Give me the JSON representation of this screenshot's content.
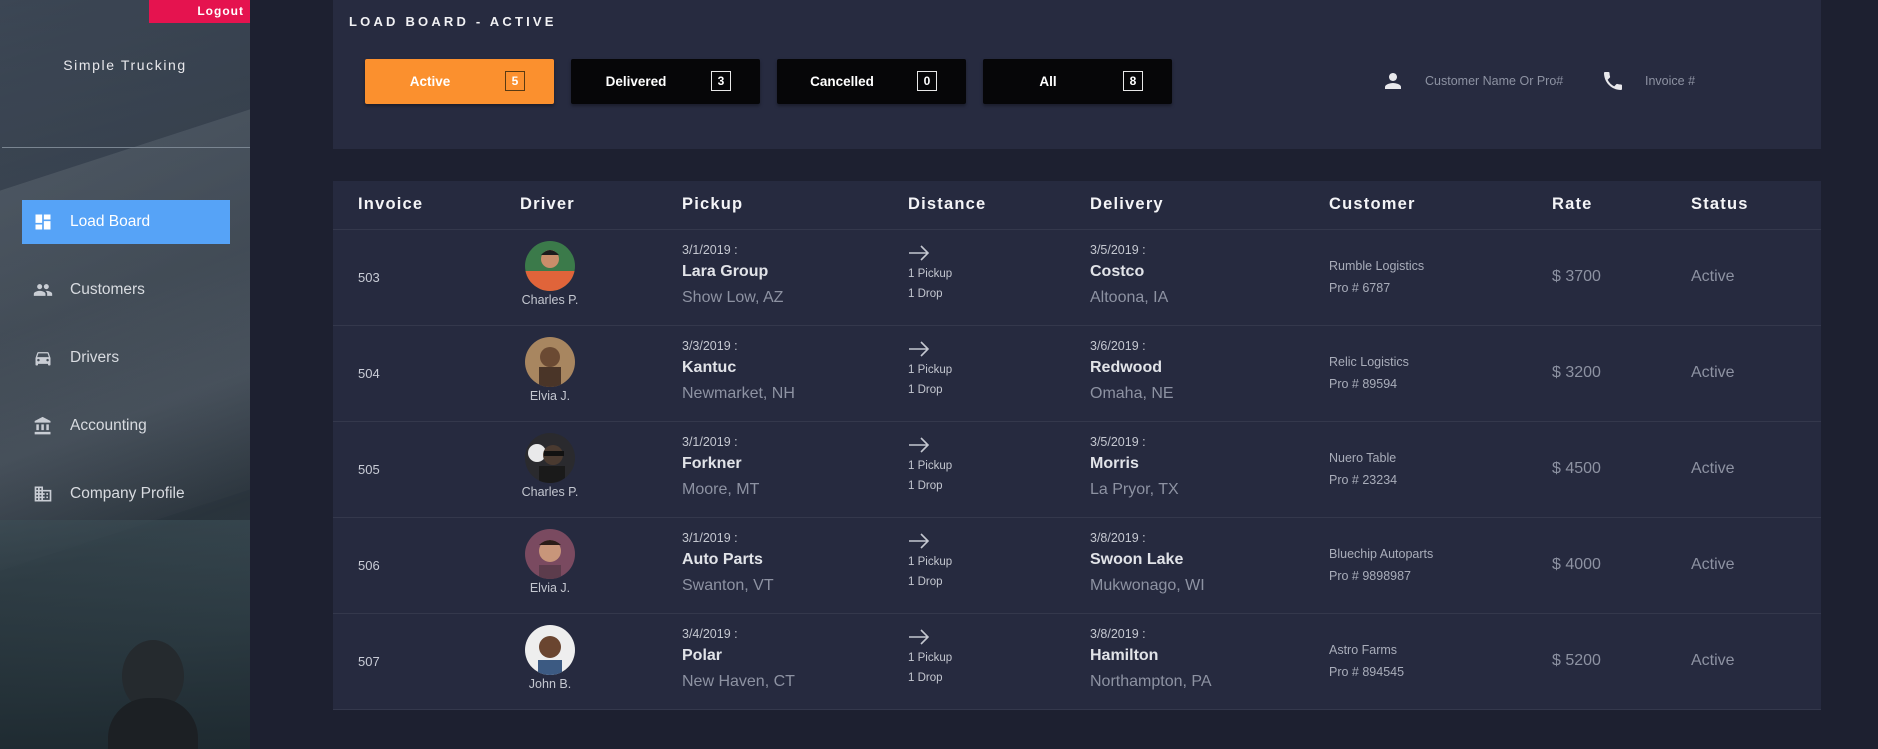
{
  "sidebar": {
    "logout": "Logout",
    "brand": "Simple Trucking",
    "nav": [
      {
        "label": "Load Board",
        "icon": "dashboard-icon",
        "active": true
      },
      {
        "label": "Customers",
        "icon": "people-icon",
        "active": false
      },
      {
        "label": "Drivers",
        "icon": "car-icon",
        "active": false
      },
      {
        "label": "Accounting",
        "icon": "bank-icon",
        "active": false
      },
      {
        "label": "Company Profile",
        "icon": "building-icon",
        "active": false
      }
    ]
  },
  "header": {
    "title": "LOAD BOARD - ACTIVE",
    "filters": [
      {
        "label": "Active",
        "count": "5",
        "active": true
      },
      {
        "label": "Delivered",
        "count": "3",
        "active": false
      },
      {
        "label": "Cancelled",
        "count": "0",
        "active": false
      },
      {
        "label": "All",
        "count": "8",
        "active": false
      }
    ],
    "search_customer": {
      "placeholder": "Customer Name Or Pro#",
      "value": "",
      "icon": "person-icon"
    },
    "search_invoice": {
      "placeholder": "Invoice #",
      "value": "",
      "icon": "phone-icon"
    }
  },
  "table": {
    "columns": [
      "Invoice",
      "Driver",
      "Pickup",
      "Distance",
      "Delivery",
      "Customer",
      "Rate",
      "Status"
    ],
    "rows": [
      {
        "invoice": "503",
        "driver": "Charles P.",
        "pickup_date": "3/1/2019 :",
        "pickup_name": "Lara Group",
        "pickup_city": "Show Low, AZ",
        "pickups": "1 Pickup",
        "drops": "1 Drop",
        "delivery_date": "3/5/2019 :",
        "delivery_name": "Costco",
        "delivery_city": "Altoona, IA",
        "customer": "Rumble Logistics",
        "pro": "Pro # 6787",
        "rate": "$ 3700",
        "status": "Active"
      },
      {
        "invoice": "504",
        "driver": "Elvia J.",
        "pickup_date": "3/3/2019 :",
        "pickup_name": "Kantuc",
        "pickup_city": "Newmarket, NH",
        "pickups": "1 Pickup",
        "drops": "1 Drop",
        "delivery_date": "3/6/2019 :",
        "delivery_name": "Redwood",
        "delivery_city": "Omaha, NE",
        "customer": "Relic Logistics",
        "pro": "Pro # 89594",
        "rate": "$ 3200",
        "status": "Active"
      },
      {
        "invoice": "505",
        "driver": "Charles P.",
        "pickup_date": "3/1/2019 :",
        "pickup_name": "Forkner",
        "pickup_city": "Moore, MT",
        "pickups": "1 Pickup",
        "drops": "1 Drop",
        "delivery_date": "3/5/2019 :",
        "delivery_name": "Morris",
        "delivery_city": "La Pryor, TX",
        "customer": "Nuero Table",
        "pro": "Pro # 23234",
        "rate": "$ 4500",
        "status": "Active"
      },
      {
        "invoice": "506",
        "driver": "Elvia J.",
        "pickup_date": "3/1/2019 :",
        "pickup_name": "Auto Parts",
        "pickup_city": "Swanton, VT",
        "pickups": "1 Pickup",
        "drops": "1 Drop",
        "delivery_date": "3/8/2019 :",
        "delivery_name": "Swoon Lake",
        "delivery_city": "Mukwonago, WI",
        "customer": "Bluechip Autoparts",
        "pro": "Pro # 9898987",
        "rate": "$ 4000",
        "status": "Active"
      },
      {
        "invoice": "507",
        "driver": "John B.",
        "pickup_date": "3/4/2019 :",
        "pickup_name": "Polar",
        "pickup_city": "New Haven, CT",
        "pickups": "1 Pickup",
        "drops": "1 Drop",
        "delivery_date": "3/8/2019 :",
        "delivery_name": "Hamilton",
        "delivery_city": "Northampton, PA",
        "customer": "Astro Farms",
        "pro": "Pro # 894545",
        "rate": "$ 5200",
        "status": "Active"
      }
    ]
  },
  "colors": {
    "accent_active_filter": "#fb902e",
    "nav_active": "#56a3f7",
    "logout": "#e5134f",
    "panel": "#272b40",
    "background": "#1d2030"
  }
}
